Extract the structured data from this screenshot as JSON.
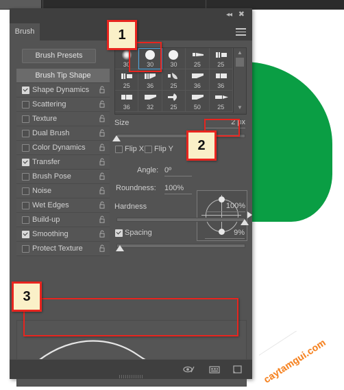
{
  "window": {
    "panel_title": "Brush",
    "collapse_icon": "double-left-chevron-icon",
    "close_icon": "close-icon",
    "menu_icon": "hamburger-menu-icon"
  },
  "left_column": {
    "presets_button": "Brush Presets",
    "header": "Brush Tip Shape",
    "options": [
      {
        "label": "Shape Dynamics",
        "checked": true
      },
      {
        "label": "Scattering",
        "checked": false
      },
      {
        "label": "Texture",
        "checked": false
      },
      {
        "label": "Dual Brush",
        "checked": false
      },
      {
        "label": "Color Dynamics",
        "checked": false
      },
      {
        "label": "Transfer",
        "checked": true
      },
      {
        "label": "Brush Pose",
        "checked": false
      },
      {
        "label": "Noise",
        "checked": false
      },
      {
        "label": "Wet Edges",
        "checked": false
      },
      {
        "label": "Build-up",
        "checked": false
      },
      {
        "label": "Smoothing",
        "checked": true
      },
      {
        "label": "Protect Texture",
        "checked": false
      }
    ]
  },
  "brush_grid": {
    "rows": [
      [
        {
          "size": "30",
          "kind": "soft-round"
        },
        {
          "size": "30",
          "kind": "hard-round",
          "selected": true
        },
        {
          "size": "30",
          "kind": "hard-round"
        },
        {
          "size": "25",
          "kind": "flat-angled"
        },
        {
          "size": "25",
          "kind": "bristle"
        }
      ],
      [
        {
          "size": "25",
          "kind": "bristle"
        },
        {
          "size": "36",
          "kind": "bristle-flat"
        },
        {
          "size": "25",
          "kind": "fan"
        },
        {
          "size": "36",
          "kind": "chisel"
        },
        {
          "size": "36",
          "kind": "flat-block"
        }
      ],
      [
        {
          "size": "36",
          "kind": "flat-block"
        },
        {
          "size": "32",
          "kind": "chisel"
        },
        {
          "size": "25",
          "kind": "round-fan"
        },
        {
          "size": "50",
          "kind": "chisel"
        },
        {
          "size": "25",
          "kind": "pointed"
        }
      ]
    ],
    "scroll_up_icon": "chevron-up-icon",
    "scroll_down_icon": "chevron-down-icon"
  },
  "settings": {
    "size_label": "Size",
    "size_value": "2 px",
    "flip_x_label": "Flip X",
    "flip_x_checked": false,
    "flip_y_label": "Flip Y",
    "flip_y_checked": false,
    "angle_label": "Angle:",
    "angle_value": "0º",
    "roundness_label": "Roundness:",
    "roundness_value": "100%",
    "hardness_label": "Hardness",
    "hardness_value": "100%",
    "spacing_label": "Spacing",
    "spacing_value": "9%",
    "spacing_checked": true
  },
  "footer": {
    "toggle_icon": "brush-toggle-eye-icon",
    "grid_icon": "grid-view-icon",
    "new_brush_icon": "new-brush-icon"
  },
  "markers": {
    "one": "1",
    "two": "2",
    "three": "3"
  },
  "watermark": {
    "text": "caytamgui.com"
  },
  "colors": {
    "panel_bg": "#535353",
    "titlebar_bg": "#3f3f3f",
    "marker_fill": "#faf0c8",
    "marker_border": "#e8251f",
    "artwork_green": "#0a9e44",
    "watermark_orange": "#f58220",
    "selection_blue": "#4aa3e0"
  }
}
